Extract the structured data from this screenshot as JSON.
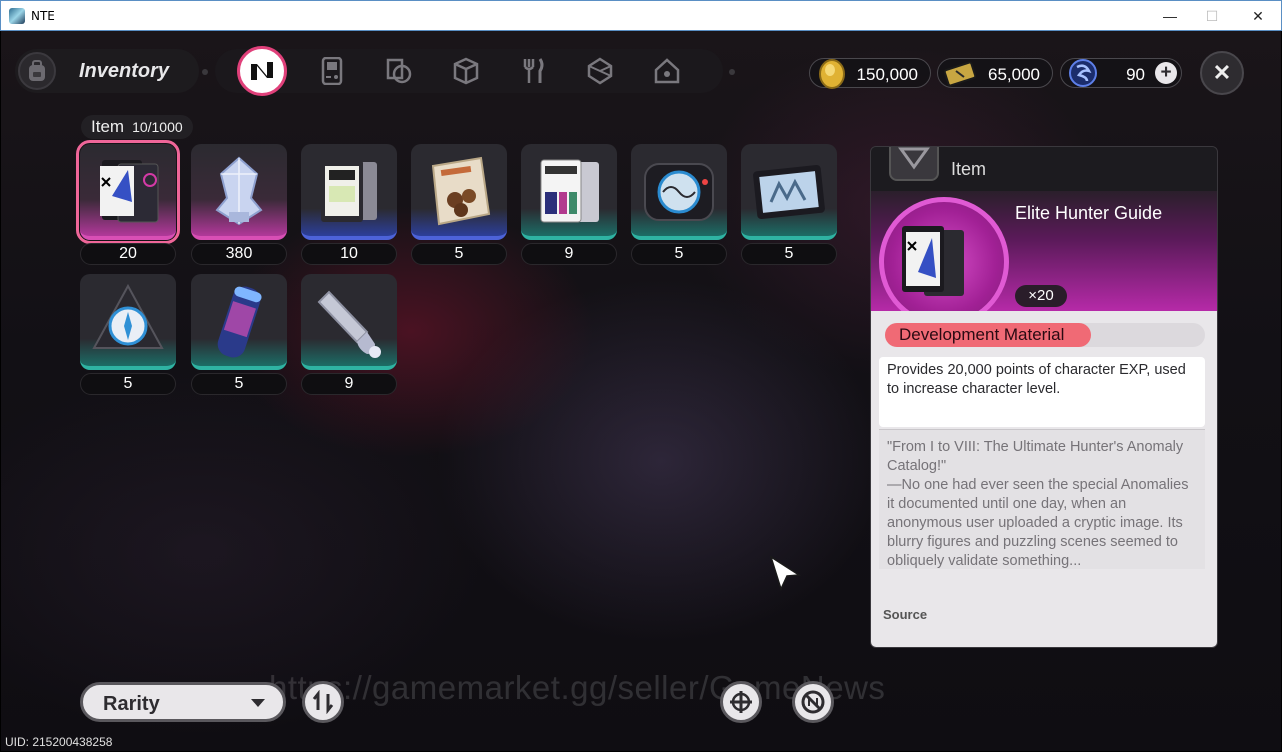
{
  "window": {
    "title": "NTE",
    "minimize": "—",
    "maximize": "☐",
    "close": "✕"
  },
  "header": {
    "inventory_label": "Inventory",
    "tabs": [
      {
        "name": "tab-all",
        "glyph": "N",
        "active": true
      },
      {
        "name": "tab-device",
        "glyph": "▯"
      },
      {
        "name": "tab-documents",
        "glyph": "◧"
      },
      {
        "name": "tab-box",
        "glyph": "▣"
      },
      {
        "name": "tab-food",
        "glyph": "ψ"
      },
      {
        "name": "tab-material",
        "glyph": "◈"
      },
      {
        "name": "tab-home",
        "glyph": "⌂"
      }
    ],
    "currencies": [
      {
        "name": "gold-coin",
        "value": "150,000",
        "color": "#e0b233"
      },
      {
        "name": "ticket",
        "value": "65,000",
        "color": "#c8a642"
      },
      {
        "name": "crystal",
        "value": "90",
        "color": "#3d63d6"
      }
    ],
    "close": "✕"
  },
  "grid": {
    "caption": "Item",
    "capacity": "10/1000",
    "items": [
      {
        "count": "20",
        "rarity": "pink",
        "selected": true
      },
      {
        "count": "380",
        "rarity": "pink"
      },
      {
        "count": "10",
        "rarity": "blue"
      },
      {
        "count": "5",
        "rarity": "blue"
      },
      {
        "count": "9",
        "rarity": "green"
      },
      {
        "count": "5",
        "rarity": "green"
      },
      {
        "count": "5",
        "rarity": "green"
      },
      {
        "count": "5",
        "rarity": "green"
      },
      {
        "count": "5",
        "rarity": "green"
      },
      {
        "count": "9",
        "rarity": "green"
      }
    ]
  },
  "detail": {
    "header": "Item",
    "name": "Elite Hunter Guide",
    "quantity": "×20",
    "tag": "Development Material",
    "description": "Provides 20,000 points of character EXP, used to increase character level.",
    "lore": "\"From I to VIII: The Ultimate Hunter's Anomaly Catalog!\"\n—No one had ever seen the special Anomalies it documented until one day, when an anonymous user uploaded a cryptic image. Its blurry figures and puzzling scenes seemed to obliquely validate something...",
    "source_label": "Source"
  },
  "footer": {
    "sort_label": "Rarity",
    "watermark": "https://gamemarket.gg/seller/GameNews",
    "uid": "UID: 215200438258"
  }
}
